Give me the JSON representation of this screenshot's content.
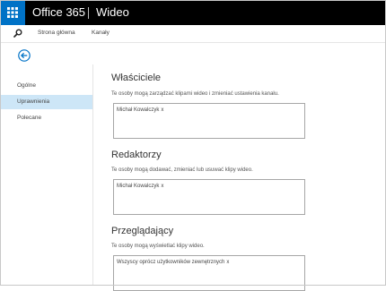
{
  "header": {
    "brand": "Office 365",
    "app_name": "Wideo",
    "waffle_icon": "app-launcher-icon",
    "accent_color": "#0072c6"
  },
  "nav": {
    "search_icon": "search-icon",
    "home": "Strona główna",
    "channels": "Kanały"
  },
  "sidebar": {
    "back_icon": "back-arrow-icon",
    "items": [
      {
        "label": "Ogólne",
        "selected": false
      },
      {
        "label": "Uprawnienia",
        "selected": true
      },
      {
        "label": "Polecane",
        "selected": false
      }
    ]
  },
  "sections": {
    "owners": {
      "title": "Właściciele",
      "description": "Te osoby mogą zarządzać klipami wideo i zmieniać ustawienia kanału.",
      "people": [
        {
          "name": "Michał Kowalczyk",
          "remove": "x"
        }
      ]
    },
    "editors": {
      "title": "Redaktorzy",
      "description": "Te osoby mogą dodawać, zmieniać lub usuwać klipy wideo.",
      "people": [
        {
          "name": "Michał Kowalczyk",
          "remove": "x"
        }
      ]
    },
    "viewers": {
      "title": "Przeglądający",
      "description": "Te osoby mogą wyświetlać klipy wideo.",
      "people": [
        {
          "name": "Wszyscy oprócz użytkowników zewnętrznych",
          "remove": "x"
        }
      ]
    }
  }
}
